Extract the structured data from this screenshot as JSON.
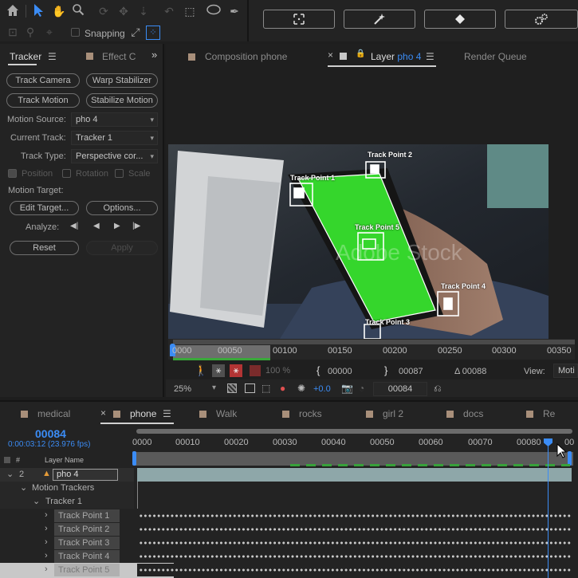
{
  "toolbar": {
    "snapping_label": "Snapping",
    "workspace_buttons": [
      {
        "icon": "selection-bracket-icon",
        "glyph": "⌗"
      },
      {
        "icon": "magic-wand-icon",
        "glyph": "⚚"
      },
      {
        "icon": "diamond-icon",
        "glyph": "◆"
      },
      {
        "icon": "settings-gears-icon",
        "glyph": "⚙"
      }
    ]
  },
  "left_panel": {
    "tabs": [
      "Tracker",
      "Effect C"
    ],
    "track_camera": "Track Camera",
    "warp_stabilizer": "Warp Stabilizer",
    "track_motion": "Track Motion",
    "stabilize_motion": "Stabilize Motion",
    "motion_source_label": "Motion Source:",
    "motion_source_value": "pho 4",
    "current_track_label": "Current Track:",
    "current_track_value": "Tracker 1",
    "track_type_label": "Track Type:",
    "track_type_value": "Perspective cor...",
    "position_label": "Position",
    "rotation_label": "Rotation",
    "scale_label": "Scale",
    "motion_target_label": "Motion Target:",
    "edit_target": "Edit Target...",
    "options": "Options...",
    "analyze_label": "Analyze:",
    "analyze_glyphs": [
      "◀|",
      "◀",
      "▶",
      "|▶"
    ],
    "reset": "Reset",
    "apply": "Apply"
  },
  "viewer": {
    "tabs": {
      "composition": "Composition phone",
      "layer_prefix": "Layer",
      "layer_name": "pho 4",
      "render_queue": "Render Queue"
    },
    "track_points": [
      "Track Point 1",
      "Track Point 2",
      "Track Point 5",
      "Track Point 4",
      "Track Point 3"
    ],
    "watermark": "Adobe Stock",
    "ruler_labels": [
      "0000",
      "00050",
      "00100",
      "00150",
      "00200",
      "00250",
      "00300",
      "00350"
    ],
    "controls": {
      "zoom_pct": "100 %",
      "in_point": "00000",
      "out_point": "00087",
      "duration": "Δ 00088",
      "view_label": "View:",
      "view_value": "Moti"
    },
    "bottom_bar": {
      "zoom": "25%",
      "exposure": "+0.0",
      "frame": "00084"
    }
  },
  "timeline": {
    "tabs": [
      "medical",
      "phone",
      "Walk",
      "rocks",
      "girl 2",
      "docs",
      "Re"
    ],
    "current_frame": "00084",
    "timecode": "0:00:03:12 (23.976 fps)",
    "ruler_labels": [
      "0000",
      "00010",
      "00020",
      "00030",
      "00040",
      "00050",
      "00060",
      "00070",
      "00080",
      "00"
    ],
    "columns": {
      "num": "#",
      "layer_name": "Layer Name"
    },
    "layer": {
      "num": "2",
      "name": "pho 4"
    },
    "rows": {
      "motion_trackers": "Motion Trackers",
      "tracker": "Tracker 1",
      "track_points": [
        "Track Point 1",
        "Track Point 2",
        "Track Point 3",
        "Track Point 4",
        "Track Point 5"
      ]
    },
    "accent_color": "#3b8cf5"
  }
}
